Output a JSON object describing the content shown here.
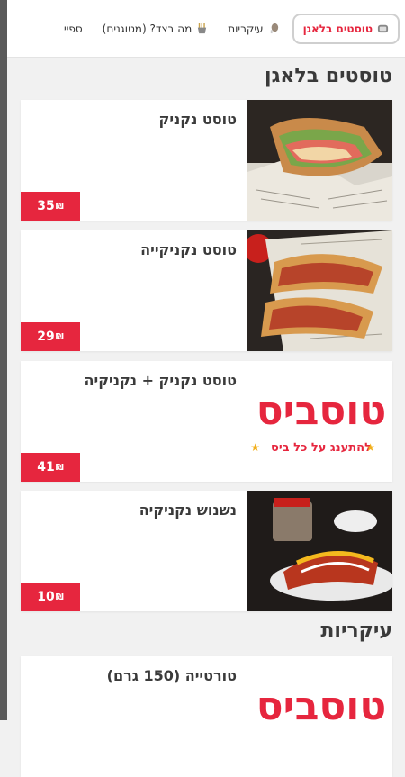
{
  "tabs": [
    {
      "label": "טוסטים בלאגן",
      "active": true,
      "icon": "toast-icon"
    },
    {
      "label": "עיקריות",
      "active": false,
      "icon": "drumstick-icon"
    },
    {
      "label": "מה בצד? (מטוגנים)",
      "active": false,
      "icon": "fries-icon"
    },
    {
      "label": "ספיי",
      "active": false,
      "icon": ""
    }
  ],
  "sections": [
    {
      "title": "טוסטים בלאגן",
      "items": [
        {
          "name": "טוסט נקניק",
          "price": "35",
          "currency": "₪",
          "image": "toast-wrap-photo"
        },
        {
          "name": "טוסט נקניקייה",
          "price": "29",
          "currency": "₪",
          "image": "toast-sausage-photo"
        },
        {
          "name": "טוסט נקניק + נקניקיה",
          "price": "41",
          "currency": "₪",
          "image": "tosbis-logo"
        },
        {
          "name": "נשנוש נקניקיה",
          "price": "10",
          "currency": "₪",
          "image": "sausage-snack-photo"
        }
      ]
    },
    {
      "title": "עיקריות",
      "items": [
        {
          "name": "טורטייה (150 גרם)",
          "price": "",
          "currency": "₪",
          "image": "tosbis-logo"
        }
      ]
    }
  ],
  "logo": {
    "brand_text": "טוסביס",
    "tagline": "להתענג על כל ביס"
  },
  "colors": {
    "accent": "#e6263e",
    "background": "#f1f1f1",
    "card": "#ffffff",
    "text": "#3a3a3a"
  }
}
